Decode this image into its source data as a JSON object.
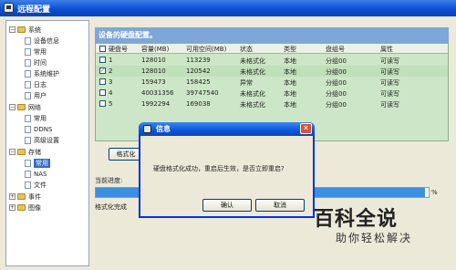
{
  "window": {
    "title": "远程配置"
  },
  "sidebar": {
    "items": [
      {
        "label": "系统"
      },
      {
        "label": "设备信息"
      },
      {
        "label": "常用"
      },
      {
        "label": "时间"
      },
      {
        "label": "系统维护"
      },
      {
        "label": "日志"
      },
      {
        "label": "用户"
      },
      {
        "label": "网络"
      },
      {
        "label": "常用"
      },
      {
        "label": "DDNS"
      },
      {
        "label": "高级设置"
      },
      {
        "label": "存储"
      },
      {
        "label": "常用"
      },
      {
        "label": "NAS"
      },
      {
        "label": "文件"
      },
      {
        "label": "事件"
      },
      {
        "label": "图像"
      }
    ]
  },
  "content": {
    "header": "设备的硬盘配置。",
    "columns": [
      "硬盘号",
      "容量(MB)",
      "可用空间(MB)",
      "状态",
      "类型",
      "盘组号",
      "属性"
    ],
    "rows": [
      {
        "checked": false,
        "no": "1",
        "capacity": "128010",
        "free": "113239",
        "status": "未格式化",
        "type": "本地",
        "group": "分组00",
        "attr": "可读写"
      },
      {
        "checked": true,
        "no": "2",
        "capacity": "128010",
        "free": "120542",
        "status": "未格式化",
        "type": "本地",
        "group": "分组00",
        "attr": "可读写"
      },
      {
        "checked": false,
        "no": "3",
        "capacity": "159473",
        "free": "158425",
        "status": "异常",
        "type": "本地",
        "group": "分组00",
        "attr": "可读写"
      },
      {
        "checked": false,
        "no": "4",
        "capacity": "40031356",
        "free": "39747540",
        "status": "未格式化",
        "type": "本地",
        "group": "分组00",
        "attr": "可读写"
      },
      {
        "checked": false,
        "no": "5",
        "capacity": "1992294",
        "free": "169038",
        "status": "未格式化",
        "type": "本地",
        "group": "分组00",
        "attr": "可读写"
      }
    ],
    "format_button": "格式化",
    "progress_label": "当前进度:",
    "progress_value": 0.99,
    "progress_pct": "%",
    "status_text": "格式化完成"
  },
  "dialog": {
    "title": "信息",
    "message": "硬盘格式化成功，重启后生效，是否立即重启?",
    "ok_label": "确认",
    "cancel_label": "取消",
    "close_glyph": "✕"
  },
  "watermark": {
    "title": "百科全说",
    "subtitle": "助你轻松解决"
  }
}
